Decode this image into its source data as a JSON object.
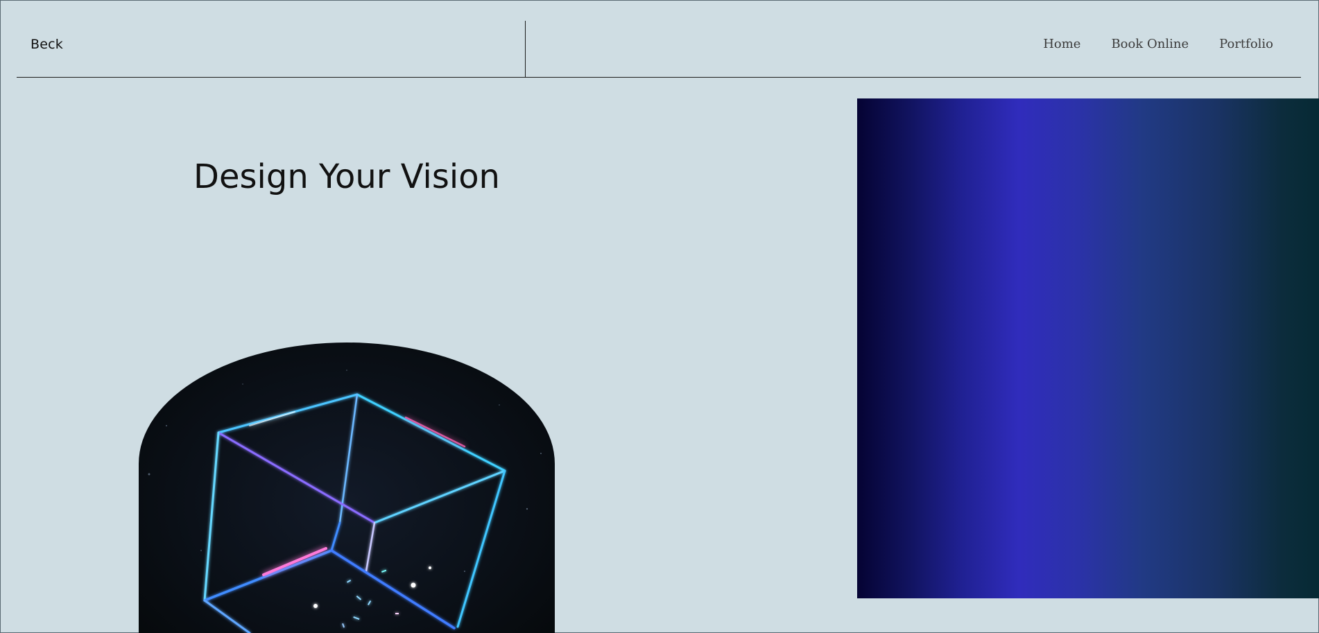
{
  "header": {
    "brand": "Beck",
    "nav": [
      {
        "label": "Home"
      },
      {
        "label": "Book Online"
      },
      {
        "label": "Portfolio"
      }
    ]
  },
  "hero": {
    "title": "Design Your Vision"
  },
  "media": {
    "arch_image": "neon-wireframe-cube-image",
    "gradient_panel": "blue-gradient-panel"
  },
  "colors": {
    "page_background": "#cfdde3",
    "text_primary": "#111111",
    "nav_text": "#3b3b3b",
    "gradient_start": "#050333",
    "gradient_mid": "#302cbc",
    "gradient_end": "#062a34"
  }
}
